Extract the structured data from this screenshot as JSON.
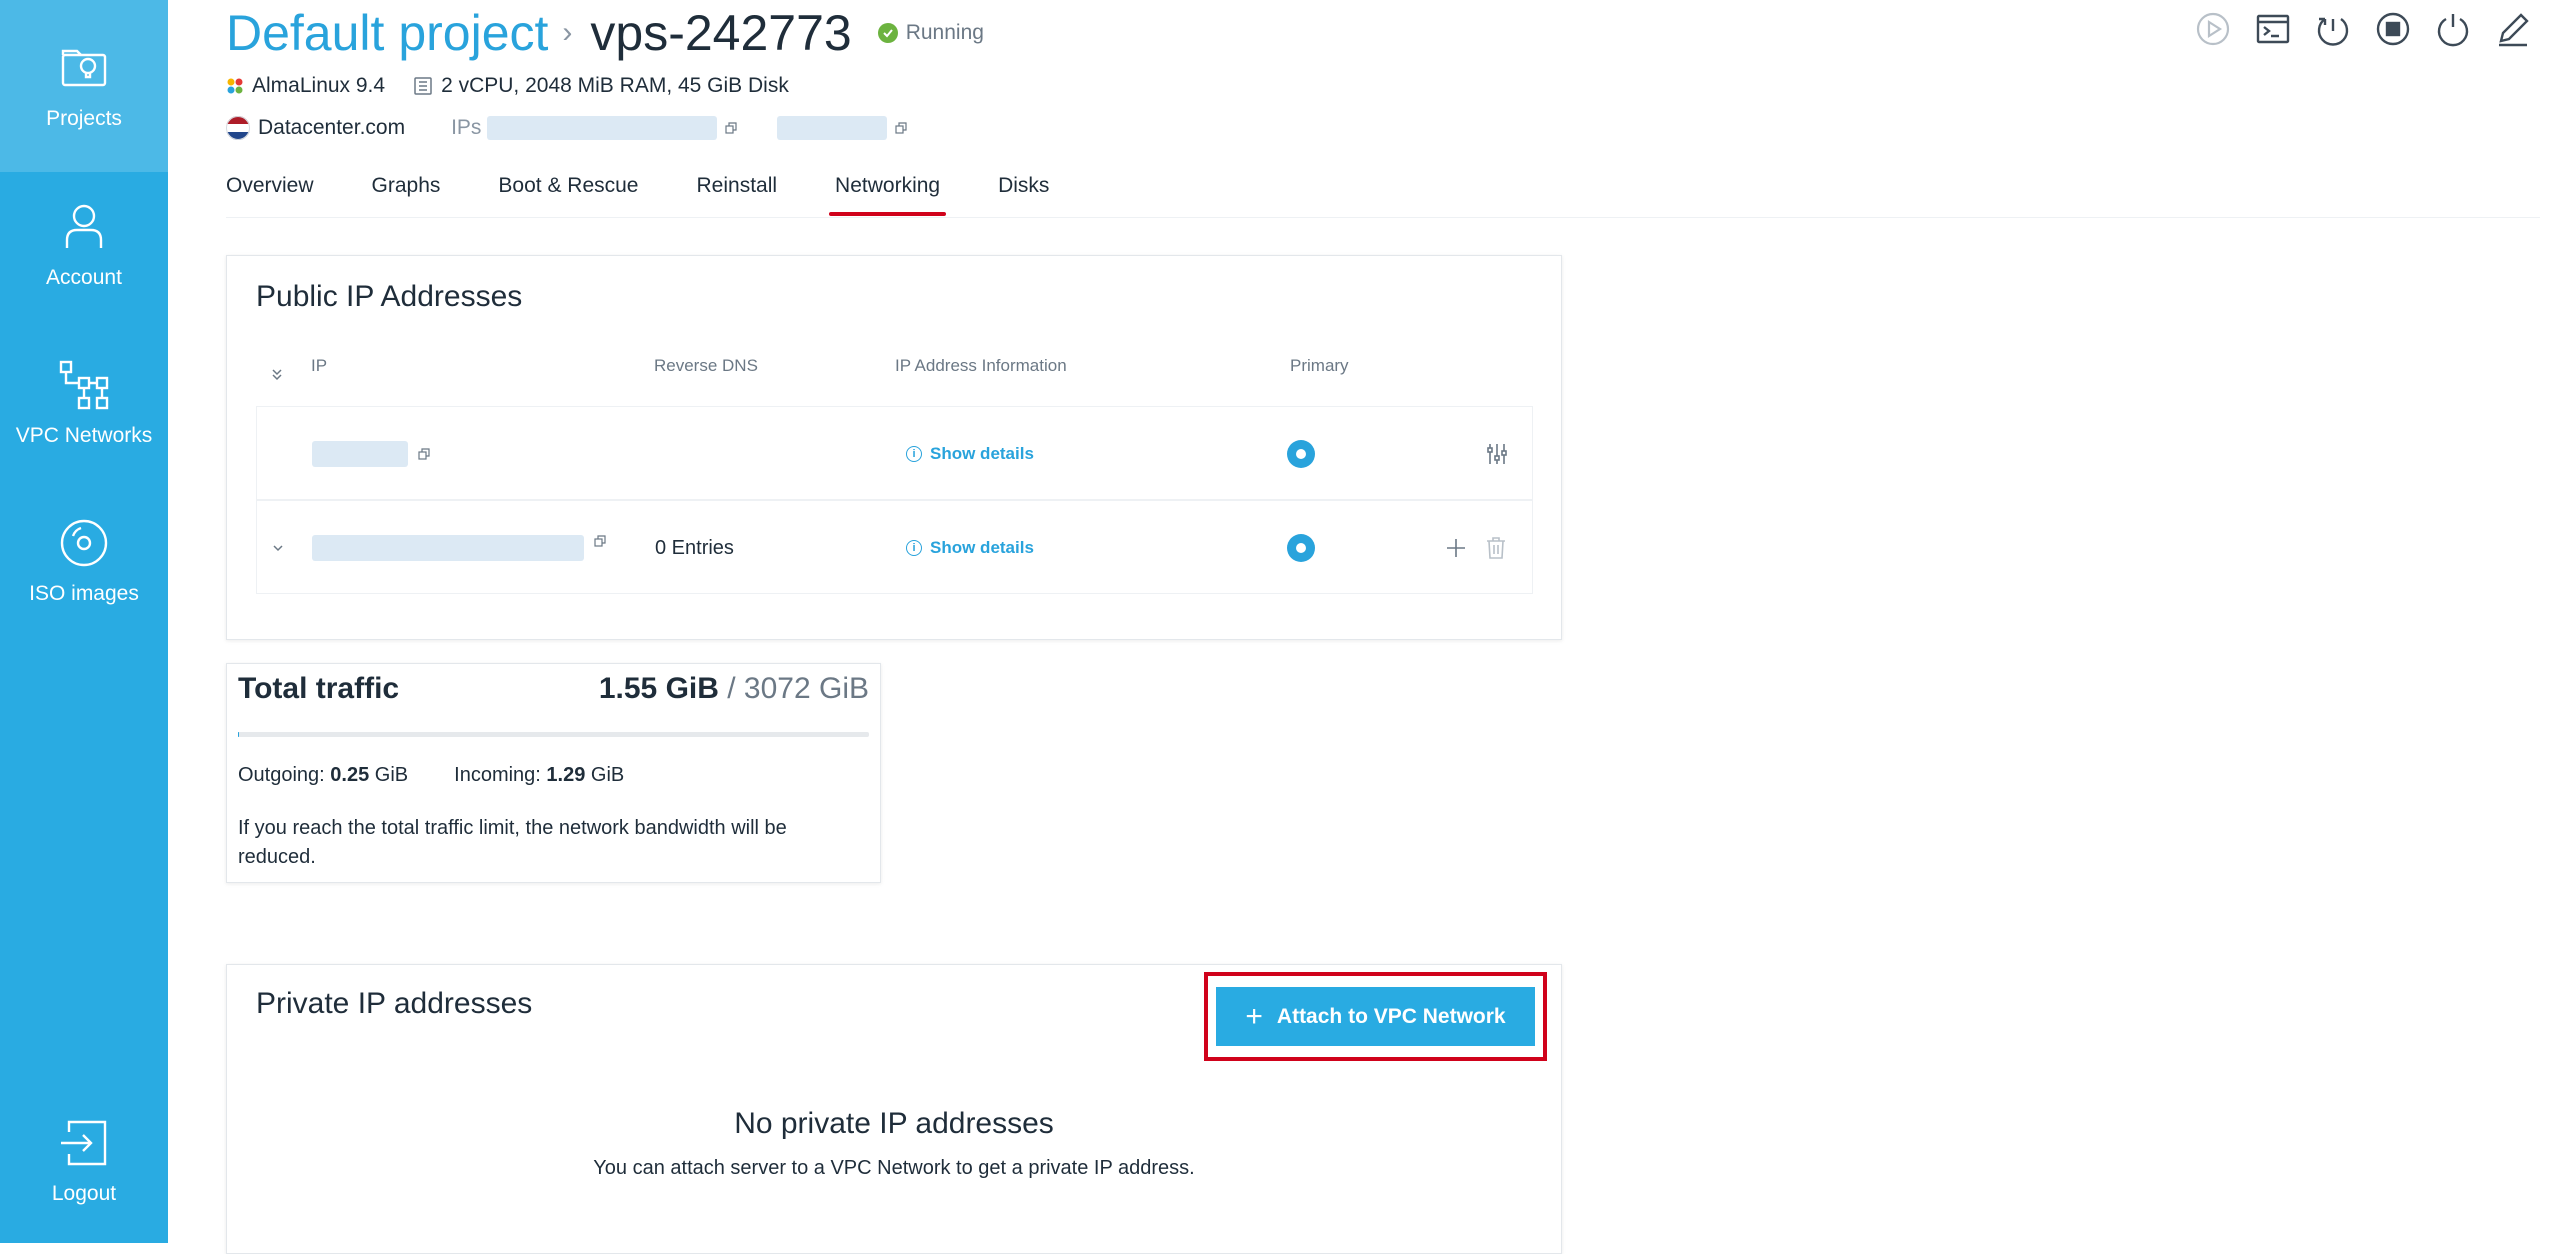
{
  "sidebar": {
    "items": [
      {
        "label": "Projects",
        "icon": "projects-icon",
        "active": true
      },
      {
        "label": "Account",
        "icon": "account-icon"
      },
      {
        "label": "VPC Networks",
        "icon": "vpc-networks-icon"
      },
      {
        "label": "ISO images",
        "icon": "iso-images-icon"
      }
    ],
    "logout": {
      "label": "Logout",
      "icon": "logout-icon"
    }
  },
  "header": {
    "project": "Default project",
    "separator": "›",
    "server": "vps-242773",
    "status": "Running",
    "os": "AlmaLinux 9.4",
    "specs": "2 vCPU, 2048 MiB RAM, 45 GiB Disk",
    "datacenter": "Datacenter.com",
    "ips_label": "IPs",
    "actions": [
      "start-icon",
      "console-icon",
      "reboot-icon",
      "stop-icon",
      "power-icon",
      "edit-icon"
    ]
  },
  "tabs": [
    "Overview",
    "Graphs",
    "Boot & Rescue",
    "Reinstall",
    "Networking",
    "Disks"
  ],
  "active_tab": "Networking",
  "public_ips": {
    "title": "Public IP Addresses",
    "columns": {
      "ip": "IP",
      "reverse_dns": "Reverse DNS",
      "info": "IP Address Information",
      "primary": "Primary"
    },
    "rows": [
      {
        "reverse_dns": "",
        "info": "Show details",
        "primary": true
      },
      {
        "reverse_dns": "0 Entries",
        "info": "Show details",
        "primary": true
      }
    ]
  },
  "traffic": {
    "title": "Total traffic",
    "used": "1.55 GiB",
    "limit": " / 3072 GiB",
    "used_fraction": 0.0005,
    "outgoing_label": "Outgoing:",
    "outgoing_value": "0.25",
    "outgoing_unit": "GiB",
    "incoming_label": "Incoming:",
    "incoming_value": "1.29",
    "incoming_unit": "GiB",
    "note": "If you reach the total traffic limit, the network bandwidth will be reduced."
  },
  "private_ips": {
    "title": "Private IP addresses",
    "attach_label": "Attach to VPC Network",
    "empty_title": "No private IP addresses",
    "empty_desc": "You can attach server to a VPC Network to get a private IP address."
  },
  "colors": {
    "accent": "#29abe2",
    "highlight": "#d0021b",
    "running": "#6cb33f"
  }
}
